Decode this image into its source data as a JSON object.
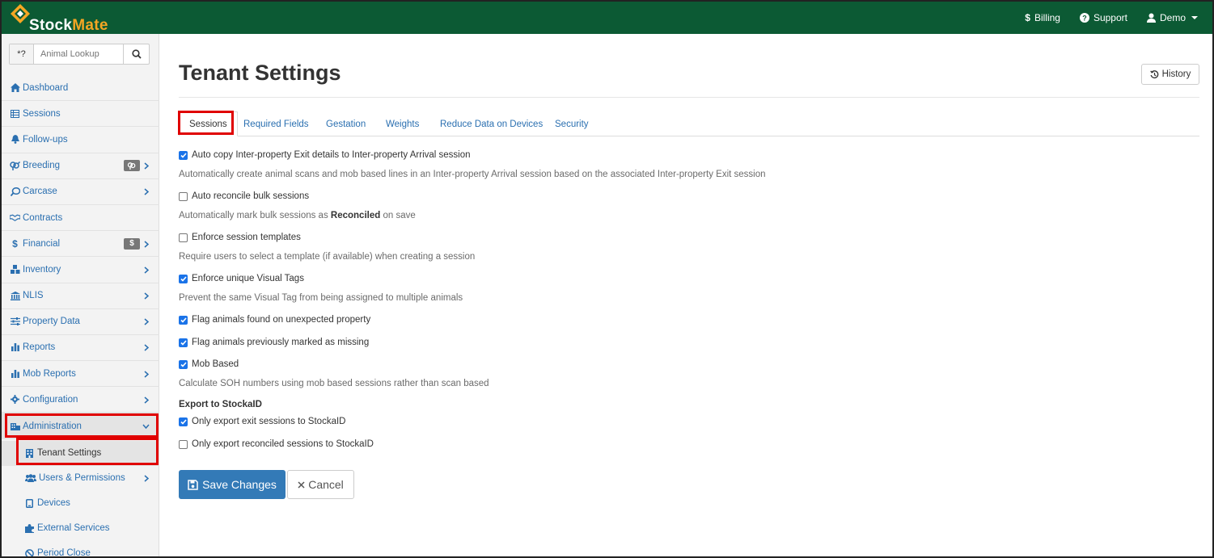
{
  "app": {
    "name_part1": "Stock",
    "name_part2": "Mate",
    "brand_green": "#0c5a34",
    "brand_orange": "#f5a623"
  },
  "topnav": {
    "billing": "Billing",
    "support": "Support",
    "user": "Demo"
  },
  "sidebar": {
    "search": {
      "prefix": "*?",
      "placeholder": "Animal Lookup"
    },
    "items": [
      {
        "label": "Dashboard",
        "icon": "home-icon"
      },
      {
        "label": "Sessions",
        "icon": "table-icon"
      },
      {
        "label": "Follow-ups",
        "icon": "bell-icon"
      },
      {
        "label": "Breeding",
        "icon": "venus-mars-icon",
        "badge_icon": "venus-mars-icon"
      },
      {
        "label": "Carcase",
        "icon": "drumstick-icon"
      },
      {
        "label": "Contracts",
        "icon": "handshake-icon"
      },
      {
        "label": "Financial",
        "icon": "dollar-icon",
        "badge": "$"
      },
      {
        "label": "Inventory",
        "icon": "boxes-icon"
      },
      {
        "label": "NLIS",
        "icon": "bank-icon"
      },
      {
        "label": "Property Data",
        "icon": "sliders-icon"
      },
      {
        "label": "Reports",
        "icon": "bar-chart-icon"
      },
      {
        "label": "Mob Reports",
        "icon": "bar-chart-icon"
      },
      {
        "label": "Configuration",
        "icon": "gear-icon"
      },
      {
        "label": "Administration",
        "icon": "building-icon"
      }
    ],
    "sub_items": [
      {
        "label": "Tenant Settings",
        "icon": "building-icon"
      },
      {
        "label": "Users & Permissions",
        "icon": "users-icon"
      },
      {
        "label": "Devices",
        "icon": "tablet-icon"
      },
      {
        "label": "External Services",
        "icon": "puzzle-icon"
      },
      {
        "label": "Period Close",
        "icon": "ban-icon"
      }
    ]
  },
  "main": {
    "title": "Tenant Settings",
    "history_label": "History",
    "tabs": [
      "Sessions",
      "Required Fields",
      "Gestation",
      "Weights",
      "Reduce Data on Devices",
      "Security"
    ],
    "options": [
      {
        "label": "Auto copy Inter-property Exit details to Inter-property Arrival session",
        "checked": true,
        "help": "Automatically create animal scans and mob based lines in an Inter-property Arrival session based on the associated Inter-property Exit session"
      },
      {
        "label": "Auto reconcile bulk sessions",
        "checked": false,
        "help_pre": "Automatically mark bulk sessions as ",
        "help_bold": "Reconciled",
        "help_post": " on save"
      },
      {
        "label": "Enforce session templates",
        "checked": false,
        "help": "Require users to select a template (if available) when creating a session"
      },
      {
        "label": "Enforce unique Visual Tags",
        "checked": true,
        "help": "Prevent the same Visual Tag from being assigned to multiple animals"
      },
      {
        "label": "Flag animals found on unexpected property",
        "checked": true
      },
      {
        "label": "Flag animals previously marked as missing",
        "checked": true
      },
      {
        "label": "Mob Based",
        "checked": true,
        "help": "Calculate SOH numbers using mob based sessions rather than scan based"
      }
    ],
    "export_section": {
      "title": "Export to StockaID",
      "options": [
        {
          "label": "Only export exit sessions to StockaID",
          "checked": true
        },
        {
          "label": "Only export reconciled sessions to StockaID",
          "checked": false
        }
      ]
    },
    "save_label": "Save Changes",
    "cancel_label": "Cancel"
  }
}
